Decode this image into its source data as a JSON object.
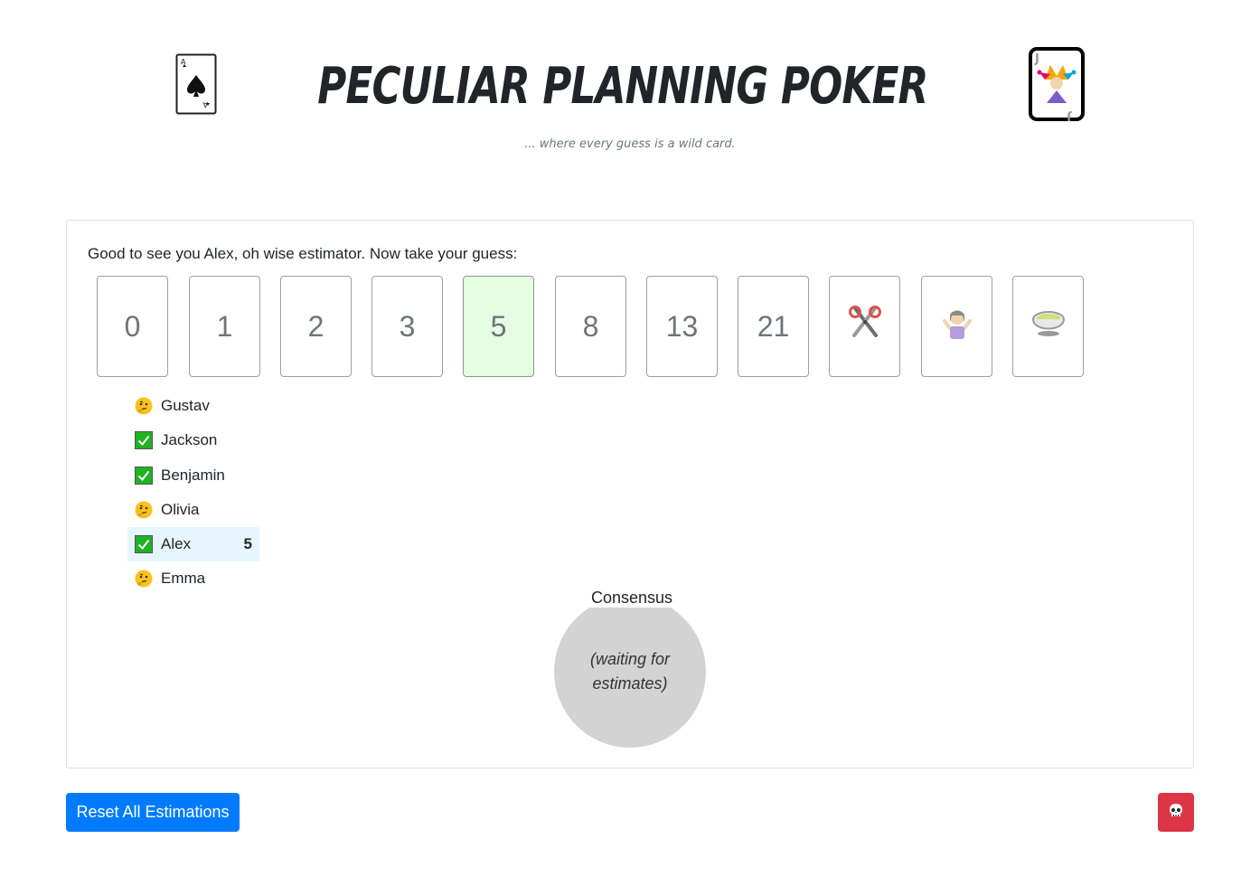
{
  "header": {
    "title": "Peculiar Planning Poker",
    "subtitle": "... where every guess is a wild card.",
    "left_icon": "ace-of-spades-card-icon",
    "right_icon": "joker-card-icon"
  },
  "greeting": "Good to see you Alex, oh wise estimator. Now take your guess:",
  "cards": [
    {
      "label": "0",
      "selected": false
    },
    {
      "label": "1",
      "selected": false
    },
    {
      "label": "2",
      "selected": false
    },
    {
      "label": "3",
      "selected": false
    },
    {
      "label": "5",
      "selected": true
    },
    {
      "label": "8",
      "selected": false
    },
    {
      "label": "13",
      "selected": false
    },
    {
      "label": "21",
      "selected": false
    },
    {
      "icon": "scissors-icon",
      "selected": false
    },
    {
      "icon": "shrug-icon",
      "selected": false
    },
    {
      "icon": "tea-cup-icon",
      "selected": false
    }
  ],
  "players": [
    {
      "name": "Gustav",
      "status": "thinking",
      "estimate": ""
    },
    {
      "name": "Jackson",
      "status": "done",
      "estimate": ""
    },
    {
      "name": "Benjamin",
      "status": "done",
      "estimate": ""
    },
    {
      "name": "Olivia",
      "status": "thinking",
      "estimate": ""
    },
    {
      "name": "Alex",
      "status": "done",
      "estimate": "5",
      "is_me": true
    },
    {
      "name": "Emma",
      "status": "thinking",
      "estimate": ""
    }
  ],
  "consensus": {
    "label": "Consensus",
    "value": "(waiting for estimates)"
  },
  "actions": {
    "reset_label": "Reset All Estimations",
    "danger_icon": "skull-icon"
  },
  "colors": {
    "primary": "#007bff",
    "danger": "#dc3545",
    "selected_card": "#e5fde3",
    "me_row": "#e7f6fe",
    "check_green": "#1fb224"
  }
}
